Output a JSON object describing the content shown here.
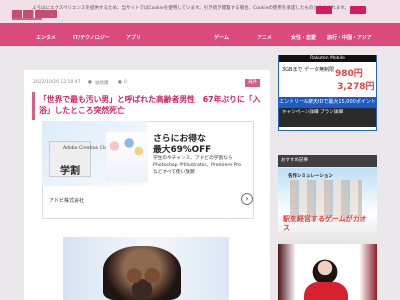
{
  "cookie": {
    "text": "よろはにエクスペリエンスを提供するため、当サイトではCookieを使用しています。引き続き閲覧する場合、Cookieの使用を承諾したものとみなされます。"
  },
  "nav": {
    "items": [
      "エンタメ",
      "IT/テクノロジー",
      "アプリ",
      "ゲーム",
      "アニメ",
      "女性・恋愛",
      "旅行・中国・アジア"
    ]
  },
  "article": {
    "date": "2022/10/26 12:10:47",
    "author": "福地康",
    "comments": "0",
    "badge": "海外",
    "title": "「世界で最も汚い男」と呼ばれた高齢者男性　67年ぶりに「入浴」したところ突然死亡"
  },
  "ad": {
    "label": "Adobe Creative Cloud",
    "label2": "学割",
    "offer1": "さらにお得な",
    "offer2": "最大69%OFF",
    "copy": "学生のやチャンス、アドビの学割なら Photoshop やIllustrator、Premiere Pro などすべて使い放題",
    "company": "アドビ株式会社",
    "next": "›"
  },
  "sidebar": {
    "top_header": "Rakuten Mobile",
    "top_text": "3GBまで\nデータ無制限",
    "top_price1": "980円",
    "top_price2": "3,278円",
    "top_blue": "エントリー&楽天IDで最大15,000ポイント",
    "top_bottom": "キャンペーン詳細\nプラン詳細",
    "section_title": "おすすめ記事",
    "game_top": "名作シミュレーション",
    "game_title": "駅を経営するゲームがカオス"
  }
}
